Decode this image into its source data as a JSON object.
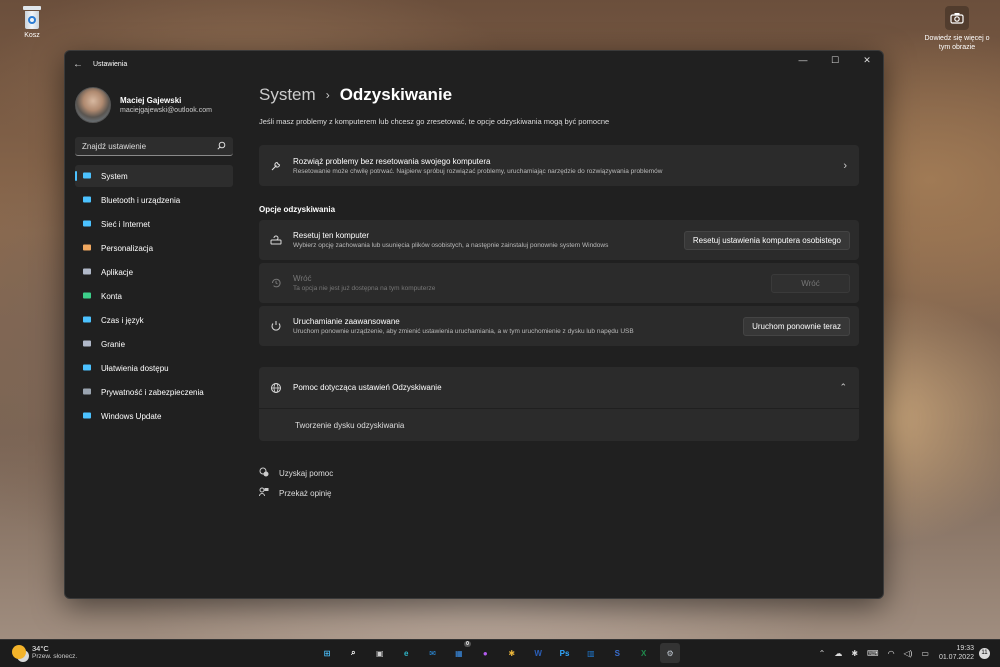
{
  "desktop": {
    "recycle_bin_label": "Kosz",
    "camera_widget_label": "Dowiedz się więcej o tym obrazie",
    "camera_icon": "camera-icon"
  },
  "window": {
    "title": "Ustawienia",
    "controls": {
      "minimize": "—",
      "maximize": "☐",
      "close": "✕"
    }
  },
  "profile": {
    "name": "Maciej Gajewski",
    "email": "maciejgajewski@outlook.com"
  },
  "search": {
    "placeholder": "Znajdź ustawienie",
    "icon": "search-icon"
  },
  "sidebar": {
    "items": [
      {
        "label": "System",
        "icon": "monitor-icon",
        "color": "#4cc2ff",
        "active": true
      },
      {
        "label": "Bluetooth i urządzenia",
        "icon": "bluetooth-icon",
        "color": "#4cc2ff"
      },
      {
        "label": "Sieć i Internet",
        "icon": "wifi-icon",
        "color": "#4cc2ff"
      },
      {
        "label": "Personalizacja",
        "icon": "brush-icon",
        "color": "#f0a860"
      },
      {
        "label": "Aplikacje",
        "icon": "apps-icon",
        "color": "#b0b8c8"
      },
      {
        "label": "Konta",
        "icon": "person-icon",
        "color": "#3ccf8a"
      },
      {
        "label": "Czas i język",
        "icon": "globe-clock-icon",
        "color": "#4cc2ff"
      },
      {
        "label": "Granie",
        "icon": "gamepad-icon",
        "color": "#b0b8c8"
      },
      {
        "label": "Ułatwienia dostępu",
        "icon": "accessibility-icon",
        "color": "#4cc2ff"
      },
      {
        "label": "Prywatność i zabezpieczenia",
        "icon": "shield-icon",
        "color": "#9aa4b0"
      },
      {
        "label": "Windows Update",
        "icon": "update-icon",
        "color": "#4cc2ff"
      }
    ]
  },
  "main": {
    "breadcrumb_parent": "System",
    "breadcrumb_sep": "›",
    "breadcrumb_current": "Odzyskiwanie",
    "intro": "Jeśli masz problemy z komputerem lub chcesz go zresetować, te opcje odzyskiwania mogą być pomocne",
    "troubleshoot": {
      "title": "Rozwiąż problemy bez resetowania swojego komputera",
      "desc": "Resetowanie może chwilę potrwać. Najpierw spróbuj rozwiązać problemy, uruchamiając narzędzie do rozwiązywania problemów",
      "icon": "wrench-icon"
    },
    "section_title": "Opcje odzyskiwania",
    "reset": {
      "title": "Resetuj ten komputer",
      "desc": "Wybierz opcję zachowania lub usunięcia plików osobistych, a następnie zainstaluj ponownie system Windows",
      "button": "Resetuj ustawienia komputera osobistego",
      "icon": "reset-pc-icon"
    },
    "goback": {
      "title": "Wróć",
      "desc": "Ta opcja nie jest już dostępna na tym komputerze",
      "button": "Wróć",
      "icon": "history-icon"
    },
    "advanced": {
      "title": "Uruchamianie zaawansowane",
      "desc": "Uruchom ponownie urządzenie, aby zmienić ustawienia uruchamiania, a w tym uruchomienie z dysku lub napędu USB",
      "button": "Uruchom ponownie teraz",
      "icon": "advanced-start-icon"
    },
    "help": {
      "title": "Pomoc dotycząca ustawień Odzyskiwanie",
      "link": "Tworzenie dysku odzyskiwania",
      "icon": "globe-icon"
    },
    "links": [
      {
        "label": "Uzyskaj pomoc",
        "icon": "help-chat-icon"
      },
      {
        "label": "Przekaż opinię",
        "icon": "feedback-icon"
      }
    ]
  },
  "taskbar": {
    "weather_temp": "34°C",
    "weather_desc": "Przew. słonecz.",
    "apps": [
      {
        "name": "start",
        "glyph": "⊞",
        "color": "#4cc2ff"
      },
      {
        "name": "search",
        "glyph": "⌕",
        "color": "#ffffff"
      },
      {
        "name": "task-view",
        "glyph": "▣",
        "color": "#cfcfcf"
      },
      {
        "name": "edge",
        "glyph": "e",
        "color": "#2fb7c9"
      },
      {
        "name": "mail",
        "glyph": "✉",
        "color": "#2b8fe0"
      },
      {
        "name": "store",
        "glyph": "▦",
        "color": "#3a8ee6",
        "badge": "0"
      },
      {
        "name": "messenger",
        "glyph": "●",
        "color": "#b45bf0"
      },
      {
        "name": "slack",
        "glyph": "✱",
        "color": "#e8b43a"
      },
      {
        "name": "word",
        "glyph": "W",
        "color": "#2b5fb8"
      },
      {
        "name": "photoshop",
        "glyph": "Ps",
        "color": "#31a8ff"
      },
      {
        "name": "trello",
        "glyph": "▥",
        "color": "#1f7ad1"
      },
      {
        "name": "outlook",
        "glyph": "S",
        "color": "#3a6fd0"
      },
      {
        "name": "excel",
        "glyph": "X",
        "color": "#1f8a4c"
      },
      {
        "name": "settings",
        "glyph": "⚙",
        "color": "#bfc7d0",
        "active": true
      }
    ],
    "time": "19:33",
    "date": "01.07.2022",
    "notifications": "11"
  }
}
